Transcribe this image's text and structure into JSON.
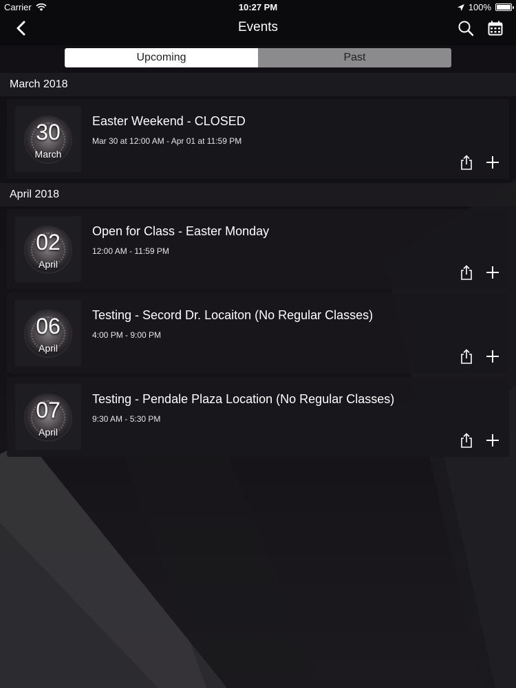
{
  "status_bar": {
    "carrier": "Carrier",
    "time": "10:27 PM",
    "battery": "100%",
    "battery_level": 1.0
  },
  "navbar": {
    "title": "Events",
    "back_icon": "chevron-left-icon",
    "search_icon": "search-icon",
    "calendar_icon": "calendar-icon"
  },
  "segments": {
    "upcoming": "Upcoming",
    "past": "Past",
    "selected": "upcoming"
  },
  "sections": [
    {
      "month": "March 2018",
      "events": [
        {
          "day": "30",
          "month": "March",
          "title": "Easter Weekend - CLOSED",
          "time": "Mar 30 at 12:00 AM - Apr 01 at 11:59 PM"
        }
      ]
    },
    {
      "month": "April 2018",
      "events": [
        {
          "day": "02",
          "month": "April",
          "title": "Open for Class - Easter Monday",
          "time": "12:00 AM - 11:59 PM"
        },
        {
          "day": "06",
          "month": "April",
          "title": "Testing - Secord Dr. Locaiton (No Regular Classes)",
          "time": "4:00 PM - 9:00 PM"
        },
        {
          "day": "07",
          "month": "April",
          "title": "Testing - Pendale Plaza Location (No Regular Classes)",
          "time": "9:30 AM - 5:30 PM"
        }
      ]
    }
  ],
  "event_action_icons": [
    "share-icon",
    "add-icon"
  ]
}
